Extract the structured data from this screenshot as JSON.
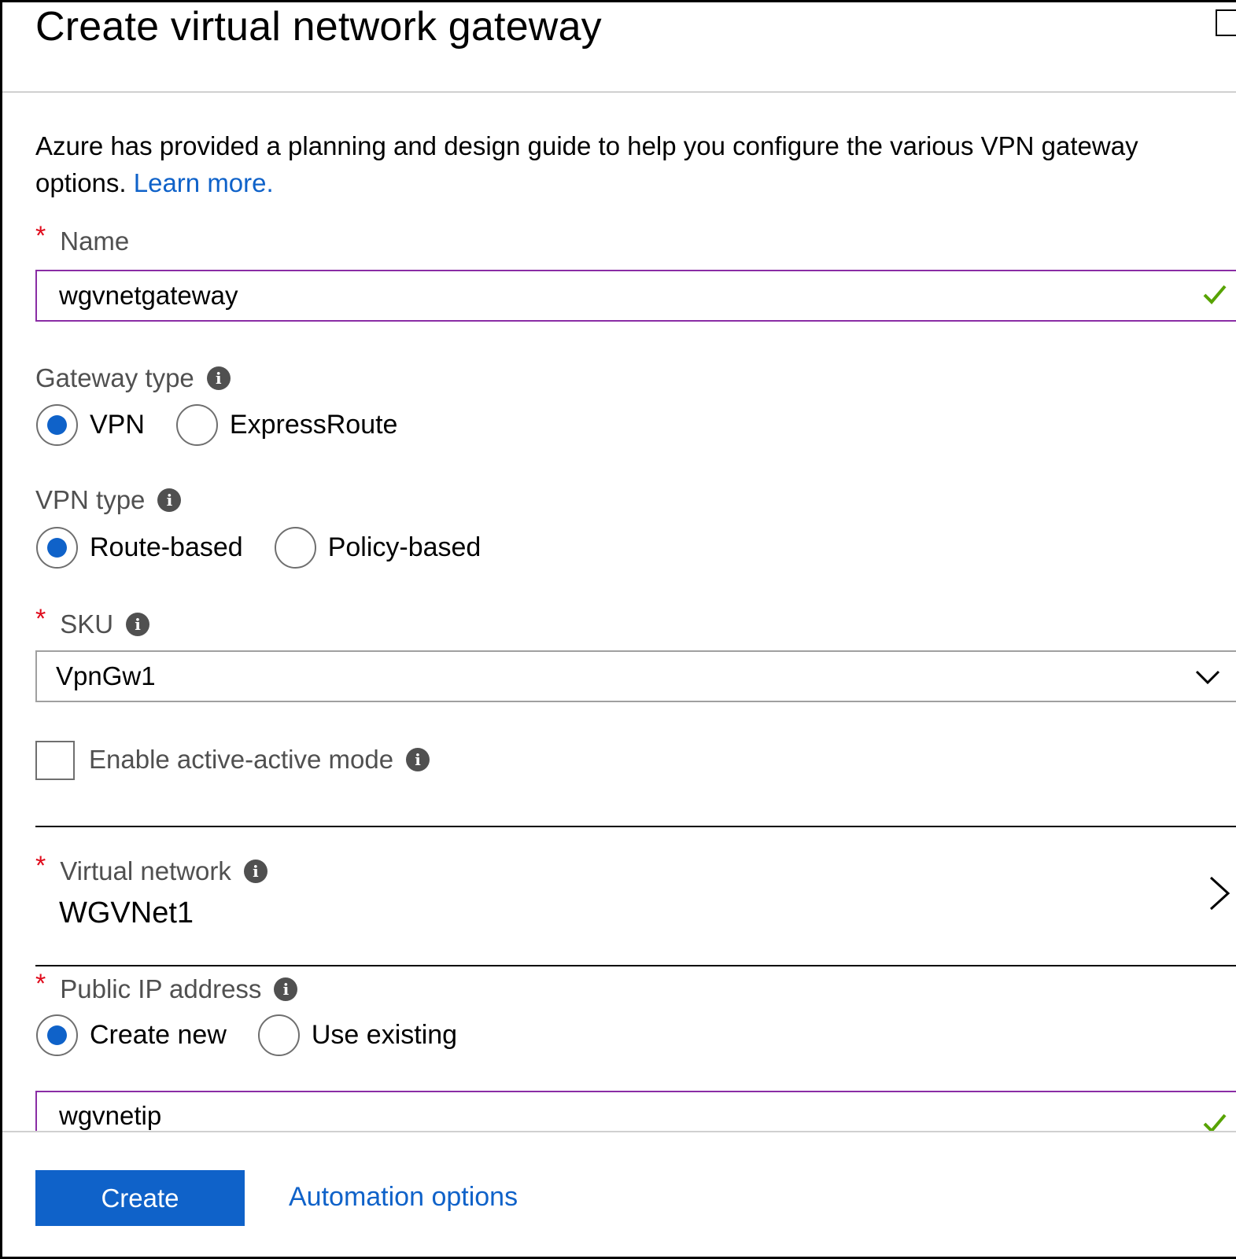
{
  "header": {
    "title": "Create virtual network gateway"
  },
  "intro": {
    "text": "Azure has provided a planning and design guide to help you configure the various VPN gateway options. ",
    "link": "Learn more."
  },
  "name_field": {
    "label": "Name",
    "value": "wgvnetgateway",
    "required": "*"
  },
  "gateway_type": {
    "label": "Gateway type",
    "options": [
      "VPN",
      "ExpressRoute"
    ],
    "selected": "VPN"
  },
  "vpn_type": {
    "label": "VPN type",
    "options": [
      "Route-based",
      "Policy-based"
    ],
    "selected": "Route-based"
  },
  "sku": {
    "label": "SKU",
    "value": "VpnGw1",
    "required": "*"
  },
  "active_active": {
    "label": "Enable active-active mode",
    "checked": false
  },
  "virtual_network": {
    "label": "Virtual network",
    "value": "WGVNet1",
    "required": "*"
  },
  "public_ip": {
    "label": "Public IP address",
    "options": [
      "Create new",
      "Use existing"
    ],
    "selected": "Create new",
    "value": "wgvnetip",
    "required": "*"
  },
  "footer": {
    "create_label": "Create",
    "automation_label": "Automation options"
  },
  "colors": {
    "accent": "#0f62c9",
    "required": "#e00b1c",
    "valid_focus_border": "#8a2da5",
    "success": "#57a300"
  }
}
